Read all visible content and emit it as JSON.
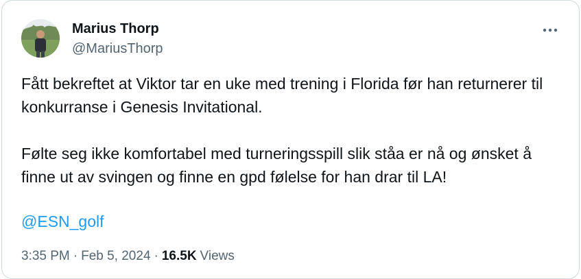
{
  "author": {
    "name": "Marius Thorp",
    "handle": "@MariusThorp"
  },
  "more_icon": "more-horizontal-icon",
  "tweet": {
    "paragraph1": "Fått bekreftet at Viktor tar en uke med trening i Florida før han returnerer til konkurranse i Genesis Invitational.",
    "paragraph2": "Følte seg ikke komfortabel med turneringsspill slik ståa er nå og ønsket å finne ut av svingen og finne en gpd følelse for han drar til LA!",
    "mention": "@ESN_golf"
  },
  "meta": {
    "time": "3:35 PM",
    "separator": "·",
    "date": "Feb 5, 2024",
    "views_count": "16.5K",
    "views_label": "Views"
  },
  "colors": {
    "text": "#0f1419",
    "secondary": "#536471",
    "link": "#1d9bf0",
    "border": "#cfd9de"
  }
}
